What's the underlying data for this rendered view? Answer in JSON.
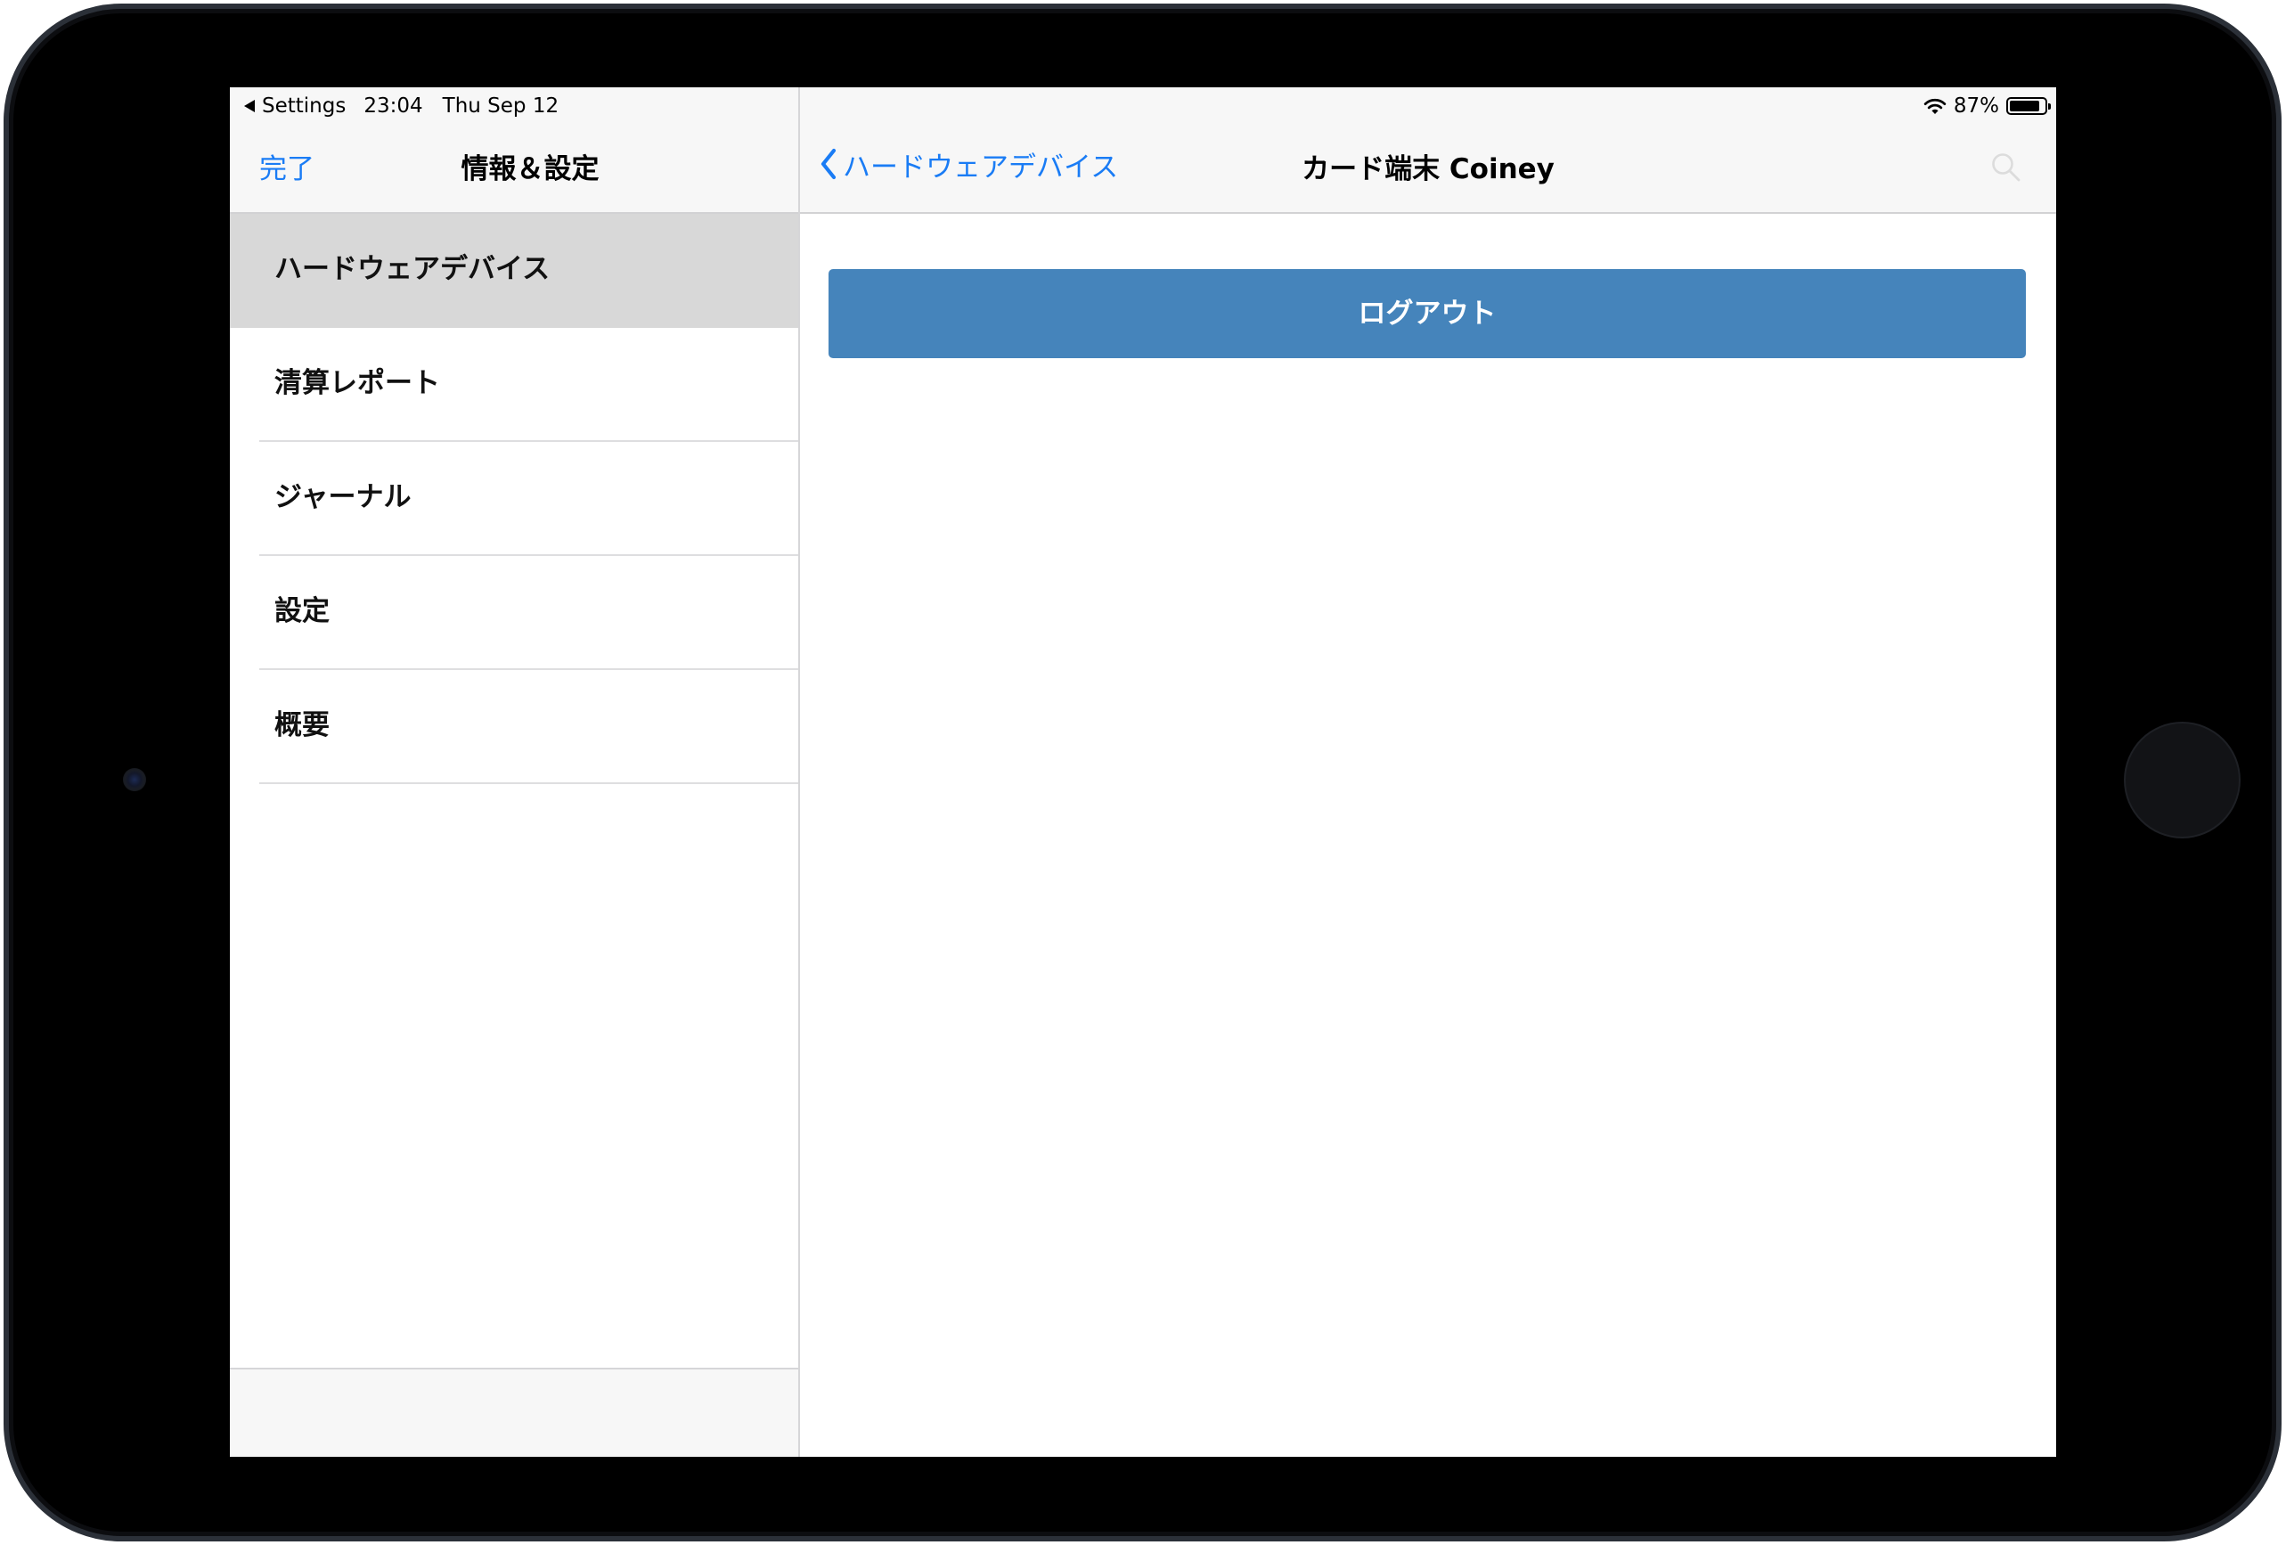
{
  "status_bar": {
    "back_app": "Settings",
    "time": "23:04",
    "date": "Thu Sep 12",
    "battery": "87%",
    "battery_level": 0.87,
    "wifi_icon": "wifi-icon"
  },
  "master": {
    "done_label": "完了",
    "title": "情報＆設定",
    "items": [
      {
        "label": "ハードウェアデバイス",
        "selected": true
      },
      {
        "label": "清算レポート",
        "selected": false
      },
      {
        "label": "ジャーナル",
        "selected": false
      },
      {
        "label": "設定",
        "selected": false
      },
      {
        "label": "概要",
        "selected": false
      }
    ]
  },
  "detail": {
    "back_label": "ハードウェアデバイス",
    "title": "カード端末 Coiney",
    "search_icon": "search-icon",
    "logout_label": "ログアウト"
  },
  "colors": {
    "accent": "#1a7cf5",
    "logout_button": "#4584bb",
    "selected_row": "#d8d8d8",
    "bar_background": "#f7f7f7"
  }
}
